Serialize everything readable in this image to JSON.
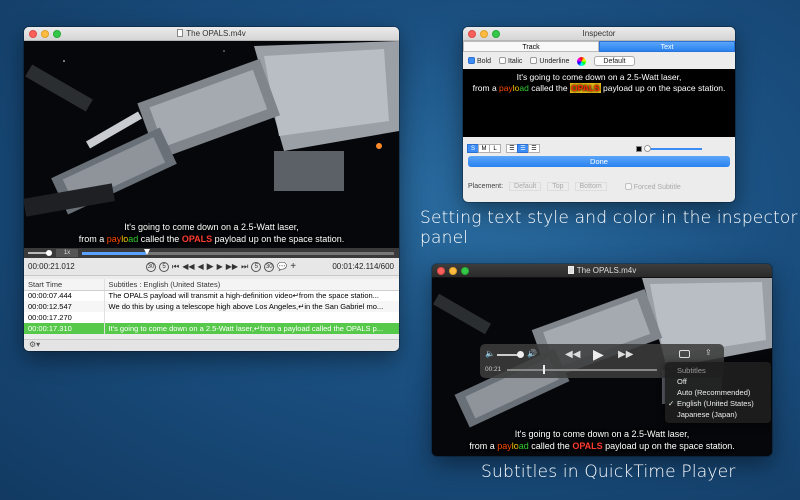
{
  "left_window": {
    "title": "The OPALS.m4v",
    "caption_line1": "It's going to come down on a 2.5-Watt laser,",
    "caption_line2": {
      "a": "from a ",
      "p1": "pay",
      "p2": "lo",
      "p3": "ad",
      "b": " called the ",
      "opals": "OPALS",
      "c": " payload up on the space station."
    },
    "speed": "1x",
    "current_time": "00:00:21.012",
    "duration": "00:01:42.114/600",
    "table": {
      "columns": [
        "Start Time",
        "Subtitles : English (United States)"
      ],
      "rows": [
        {
          "time": "00:00:07.444",
          "text": "The OPALS payload will transmit a high-definition video↵from the space station..."
        },
        {
          "time": "00:00:12.547",
          "text": "We do this by using a telescope high above Los Angeles,↵in the San Gabriel mo..."
        },
        {
          "time": "00:00:17.270",
          "text": ""
        },
        {
          "time": "00:00:17.310",
          "text": "It's going to come down on a 2.5-Watt laser,↵from a payload called the OPALS p..."
        }
      ]
    }
  },
  "inspector": {
    "title": "Inspector",
    "tabs": [
      "Track",
      "Text"
    ],
    "bold": "Bold",
    "italic": "Italic",
    "underline": "Underline",
    "default_btn": "Default",
    "preview_line1": "It's going to come down on a 2.5-Watt laser,",
    "preview_line2": {
      "a": "from a ",
      "p1": "pay",
      "p2": "lo",
      "p3": "ad",
      "b": " called the ",
      "opals": "OPALS",
      "c": " payload up on the space station."
    },
    "size_options": [
      "S",
      "M",
      "L"
    ],
    "done": "Done",
    "placement_label": "Placement:",
    "placement_options": [
      "Default",
      "Top",
      "Bottom"
    ],
    "forced_label": "Forced Subtitle"
  },
  "heading1": "Setting text style and color in the inspector panel",
  "heading2": "Subtitles in QuickTime Player",
  "qt_window": {
    "title": "The OPALS.m4v",
    "time": "00:21",
    "caption_line1": "It's going to come down on a 2.5-Watt laser,",
    "caption_line2": {
      "a": "from a ",
      "p1": "pay",
      "p2": "lo",
      "p3": "ad",
      "b": " called the ",
      "opals": "OPALS",
      "c": " payload up on the space station."
    },
    "menu": {
      "header": "Subtitles",
      "items": [
        "Off",
        "Auto (Recommended)",
        "English (United States)",
        "Japanese (Japan)"
      ],
      "checked": "English (United States)"
    }
  },
  "colors": {
    "accent": "#3b8df5",
    "selection": "#57c94a",
    "background": "#1a4f80"
  }
}
